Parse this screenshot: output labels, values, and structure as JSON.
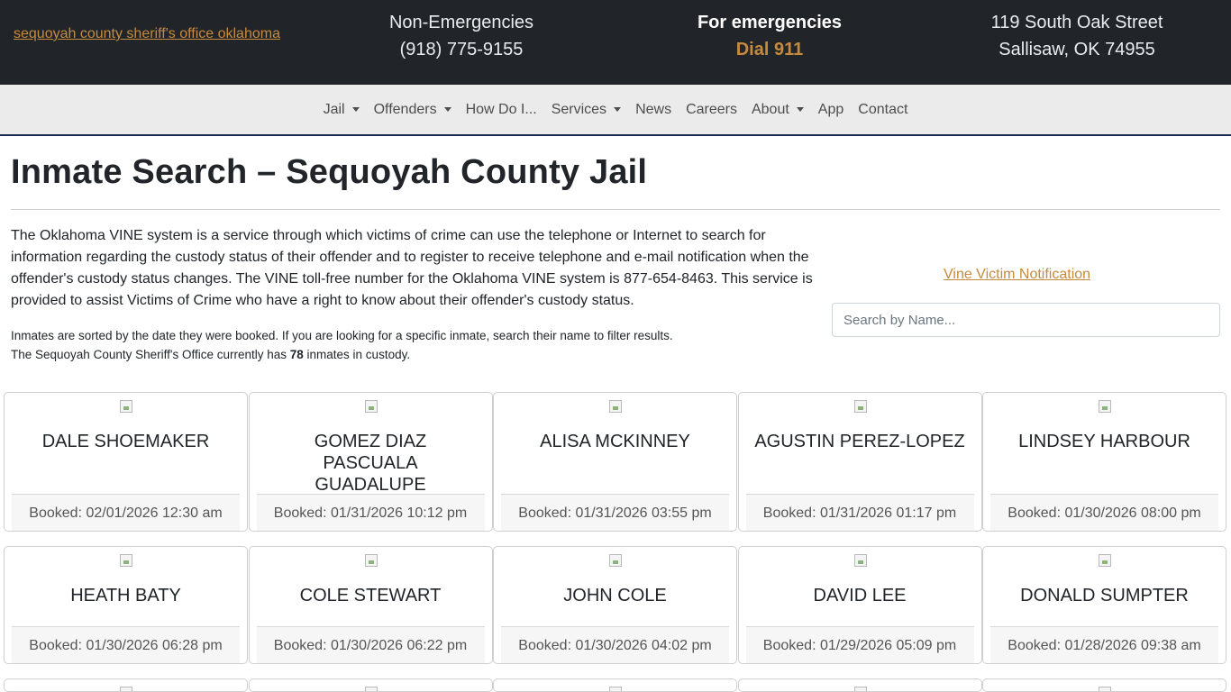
{
  "header": {
    "logo_alt": "sequoyah county sheriff's office oklahoma",
    "non_emergency_label": "Non-Emergencies",
    "non_emergency_phone": "(918) 775-9155",
    "emergency_label": "For emergencies",
    "emergency_number": "Dial 911",
    "address_line1": "119 South Oak Street",
    "address_line2": "Sallisaw, OK 74955"
  },
  "nav": {
    "items": [
      {
        "label": "Jail",
        "dropdown": true
      },
      {
        "label": "Offenders",
        "dropdown": true
      },
      {
        "label": "How Do I...",
        "dropdown": false
      },
      {
        "label": "Services",
        "dropdown": true
      },
      {
        "label": "News",
        "dropdown": false
      },
      {
        "label": "Careers",
        "dropdown": false
      },
      {
        "label": "About",
        "dropdown": true
      },
      {
        "label": "App",
        "dropdown": false
      },
      {
        "label": "Contact",
        "dropdown": false
      }
    ]
  },
  "main": {
    "title": "Inmate Search – Sequoyah County Jail",
    "intro": "The Oklahoma VINE system is a service through which victims of crime can use the telephone or Internet to search for information regarding the custody status of their offender and to register to receive telephone and e-mail notification when the offender's custody status changes. The VINE toll-free number for the Oklahoma VINE system is 877-654-8463. This service is provided to assist Victims of Crime who have a right to know about their offender's custody status.",
    "sort_note": "Inmates are sorted by the date they were booked. If you are looking for a specific inmate, search their name to filter results.",
    "count_prefix": "The Sequoyah County Sheriff's Office currently has ",
    "count_value": "78",
    "count_suffix": " inmates in custody.",
    "vine_alt": "Vine Victim Notification",
    "search_placeholder": "Search by Name..."
  },
  "inmates": [
    {
      "name": "DALE SHOEMAKER",
      "booked": "Booked: 02/01/2026 12:30 am"
    },
    {
      "name": "GOMEZ DIAZ PASCUALA GUADALUPE",
      "booked": "Booked: 01/31/2026 10:12 pm"
    },
    {
      "name": "ALISA MCKINNEY",
      "booked": "Booked: 01/31/2026 03:55 pm"
    },
    {
      "name": "AGUSTIN PEREZ-LOPEZ",
      "booked": "Booked: 01/31/2026 01:17 pm"
    },
    {
      "name": "LINDSEY HARBOUR",
      "booked": "Booked: 01/30/2026 08:00 pm"
    },
    {
      "name": "HEATH BATY",
      "booked": "Booked: 01/30/2026 06:28 pm"
    },
    {
      "name": "COLE STEWART",
      "booked": "Booked: 01/30/2026 06:22 pm"
    },
    {
      "name": "JOHN COLE",
      "booked": "Booked: 01/30/2026 04:02 pm"
    },
    {
      "name": "DAVID LEE",
      "booked": "Booked: 01/29/2026 05:09 pm"
    },
    {
      "name": "DONALD SUMPTER",
      "booked": "Booked: 01/28/2026 09:38 am"
    }
  ]
}
